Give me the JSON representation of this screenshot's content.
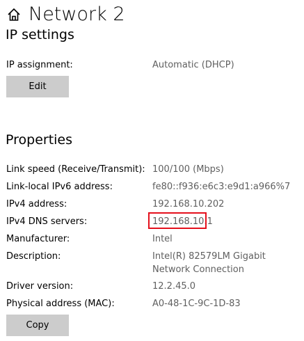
{
  "header": {
    "title": "Network 2",
    "home_icon": "home-icon"
  },
  "ip_settings": {
    "title": "IP settings",
    "assignment_label": "IP assignment:",
    "assignment_value": "Automatic (DHCP)",
    "edit_label": "Edit"
  },
  "properties": {
    "title": "Properties",
    "rows": [
      {
        "label": "Link speed (Receive/Transmit):",
        "value": "100/100 (Mbps)"
      },
      {
        "label": "Link-local IPv6 address:",
        "value": "fe80::f936:e6c3:e9d1:a966%7"
      },
      {
        "label": "IPv4 address:",
        "value": "192.168.10.202"
      },
      {
        "label": "IPv4 DNS servers:",
        "value": "192.168.10.1"
      },
      {
        "label": "Manufacturer:",
        "value": "Intel"
      },
      {
        "label": "Description:",
        "value": "Intel(R) 82579LM Gigabit Network Connection"
      },
      {
        "label": "Driver version:",
        "value": "12.2.45.0"
      },
      {
        "label": "Physical address (MAC):",
        "value": "A0-48-1C-9C-1D-83"
      }
    ],
    "copy_label": "Copy"
  },
  "colors": {
    "highlight": "#e4101c",
    "value_text": "#5f5f5f",
    "button_bg": "#cccccc"
  }
}
